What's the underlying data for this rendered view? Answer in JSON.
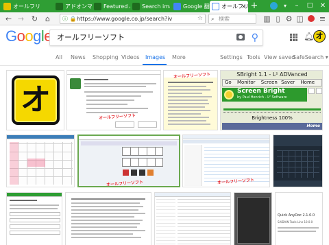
{
  "browser": {
    "tabs": [
      {
        "label": "オールフリーソフト",
        "active": false,
        "color": "#e8c200"
      },
      {
        "label": "アドオンマネー",
        "active": false,
        "color": "#2a7a2a"
      },
      {
        "label": "Featured Add",
        "active": false,
        "color": "#2a7a2a"
      },
      {
        "label": "Search image",
        "active": false,
        "color": "#2a7a2a"
      },
      {
        "label": "Google 翻訳",
        "active": false,
        "color": "#4285f4"
      },
      {
        "label": "オールフリー",
        "active": true,
        "color": "#4285f4"
      }
    ],
    "new_tab": "+",
    "tab_close": "×",
    "url": "https://www.google.co.jp/search?iv",
    "search_placeholder": "検索",
    "theme_color": "#2f9e34"
  },
  "google": {
    "logo": [
      "G",
      "o",
      "o",
      "g",
      "l",
      "e"
    ],
    "logo_colors": [
      "#4285f4",
      "#ea4335",
      "#fbbc05",
      "#4285f4",
      "#34a853",
      "#ea4335"
    ],
    "query": "オールフリーソフト",
    "avatar_letter": "オ"
  },
  "nav": {
    "all": "All",
    "news": "News",
    "shopping": "Shopping",
    "videos": "Videos",
    "images": "Images",
    "more": "More",
    "settings": "Settings",
    "tools": "Tools",
    "view_saved": "View saved",
    "safesearch": "SafeSearch ▾",
    "active_color": "#1a73e8"
  },
  "results": {
    "logo_letter": "オ",
    "watermark": "オールフリーソフト",
    "sbright": {
      "title": "SBright 1.1 - L² ADVanced",
      "menu": [
        "Go",
        "Monitor",
        "Screen",
        "Saver",
        "Home"
      ],
      "heading": "Screen Bright",
      "byline": "by Paul Henrich - L² Software",
      "brightness": "Brightness 100%",
      "brightness_level": 1.0,
      "home": "Home"
    },
    "article_title": "Quick AnyDoc 2.1.0.0",
    "article_sub": "SAIDAIN Tools Line 10.0.0"
  }
}
